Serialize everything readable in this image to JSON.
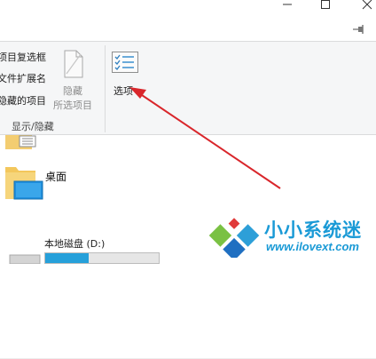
{
  "ribbon": {
    "checkbox_items": [
      {
        "label": "项目复选框"
      },
      {
        "label": "文件扩展名"
      },
      {
        "label": "隐藏的项目"
      }
    ],
    "hide_selected": {
      "line1": "隐藏",
      "line2": "所选项目"
    },
    "options_label": "选项",
    "group_label": "显示/隐藏",
    "help_glyph": "?"
  },
  "pane": {
    "desktop_label": "桌面",
    "drive": {
      "name": "本地磁盘 (D:)",
      "used_fraction": 0.38
    }
  },
  "watermark": {
    "text": "小小系统迷",
    "url": "www.ilovext.com"
  },
  "colors": {
    "accent": "#1a9ad6",
    "annotation_arrow": "#d9262b",
    "drive_fill": "#26a0da"
  }
}
